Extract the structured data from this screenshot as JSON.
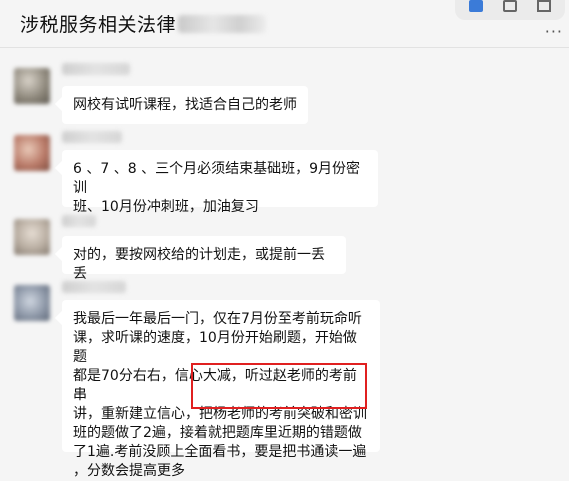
{
  "chat": {
    "title": "涉税服务相关法律"
  },
  "messages": [
    {
      "lines": [
        "网校有试听课程，找适合自己的老师"
      ]
    },
    {
      "lines": [
        "6 、7 、8 、三个月必须结束基础班，9月份密训",
        "班、10月份冲刺班，加油复习"
      ]
    },
    {
      "lines": [
        "对的，要按网校给的计划走，或提前一丢丢"
      ]
    },
    {
      "lines": [
        "我最后一年最后一门，仅在7月份至考前玩命听",
        "课，求听课的速度，10月份开始刷题，开始做题",
        "都是70分右右，信心大减，听过赵老师的考前串",
        "讲，重新建立信心，把杨老师的考前突破和密训",
        "班的题做了2遍，接着就把题库里近期的错题做",
        "了1遍.考前没顾上全面看书，要是把书通读一遍",
        "，分数会提高更多"
      ]
    }
  ],
  "colors": {
    "background": "#f5f5f5",
    "bubble": "#ffffff",
    "highlight": "#e02020"
  }
}
